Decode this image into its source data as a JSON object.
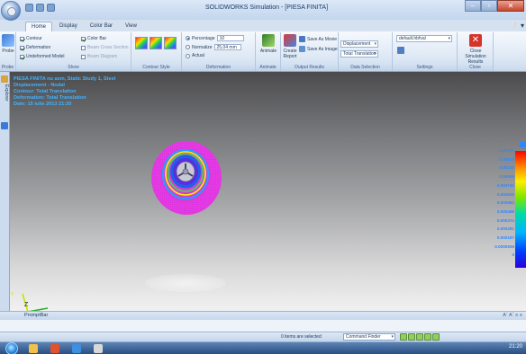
{
  "window": {
    "title": "SOLIDWORKS Simulation - [PIESA FINITA]"
  },
  "tabs": [
    {
      "label": "Home",
      "active": true
    },
    {
      "label": "Display",
      "active": false
    },
    {
      "label": "Color Bar",
      "active": false
    },
    {
      "label": "View",
      "active": false
    }
  ],
  "ribbon": {
    "probe_label": "Probe",
    "show": {
      "contour": "Contour",
      "deformation": "Deformation",
      "undeformed_model": "Undeformed Model",
      "color_bar": "Color Bar",
      "beam_cross_section": "Beam Cross Section",
      "beam_diagram": "Beam Diagram",
      "group_label": "Show"
    },
    "contour_style_label": "Contour Style",
    "deformation": {
      "percentage": "Percentage",
      "percentage_value": "10",
      "normalize": "Normalize",
      "normalize_value": "25,04 mm",
      "actual": "Actual",
      "group_label": "Deformation"
    },
    "animate": {
      "button": "Animate",
      "group_label": "Animate"
    },
    "output": {
      "create_report": "Create Report",
      "save_as_movie": "Save As Movie",
      "save_as_image": "Save As Image",
      "group_label": "Output Results"
    },
    "data_selection": {
      "result_type": "Displacement",
      "component": "Total Translation",
      "group_label": "Data Selection"
    },
    "settings": {
      "value": "default.hbfval",
      "group_label": "Settings"
    },
    "close": {
      "button": "Close Simulation Results",
      "group_label": "Close"
    }
  },
  "side_panel": {
    "item": "Explorer"
  },
  "viewport": {
    "info_lines": [
      "PIESA FINITA nu asm, Static Study 1, Steel",
      "Displacement - Nodal",
      "Contour: Total Translation",
      "Deformation: Total Translation",
      "Date: 15 iulie 2013 21:20"
    ],
    "triad": {
      "y": "Y",
      "z": "Z"
    }
  },
  "legend": {
    "values": [
      "0.00135",
      "0.00125",
      "0.00110",
      "0.00095",
      "0.000741",
      "0.000635",
      "0.000562",
      "0.000468",
      "0.000374",
      "0.000281",
      "0.000187",
      "0.0000936",
      "0"
    ]
  },
  "promptbar": {
    "title": "PromptBar",
    "right_tools": "Aˇ Aˆ ≡ ≡"
  },
  "statusbar": {
    "selection": "0 items are selected",
    "command_finder": "Command Finder"
  },
  "taskbar": {
    "clock": "21:20"
  },
  "colors": {
    "info_text": "#3fb3ff",
    "legend_text": "#2f86ff"
  }
}
